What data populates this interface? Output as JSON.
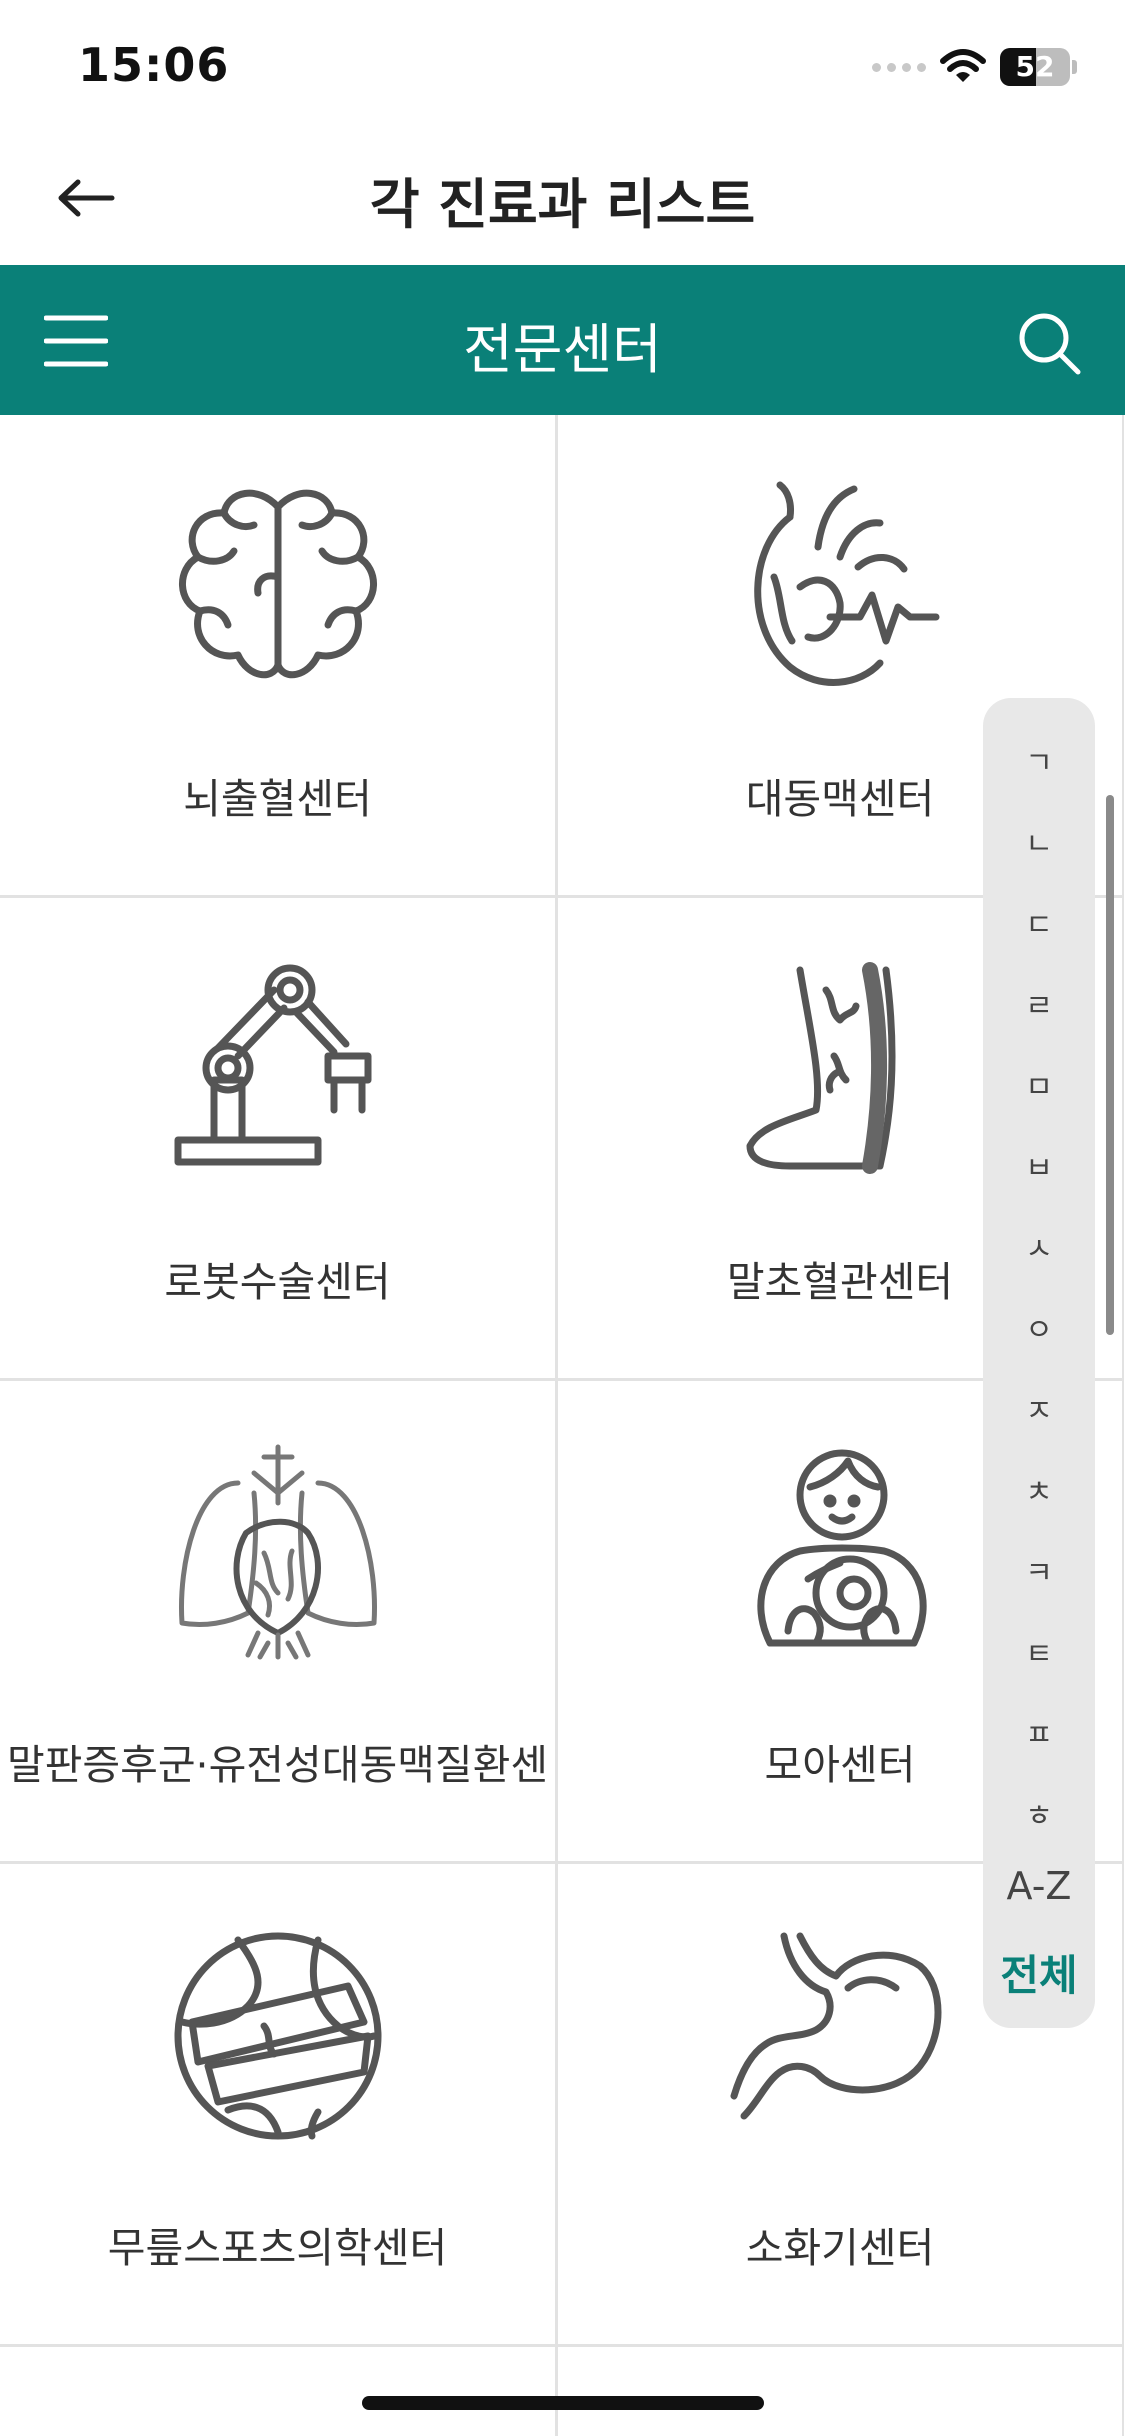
{
  "status_bar": {
    "time": "15:06",
    "battery": "52"
  },
  "nav": {
    "title": "각 진료과 리스트",
    "back_icon": "arrow-left-icon"
  },
  "header": {
    "title": "전문센터",
    "menu_icon": "hamburger-menu-icon",
    "search_icon": "search-icon",
    "color": "#0a8078"
  },
  "centers": [
    {
      "label": "뇌출혈센터",
      "icon": "brain-icon"
    },
    {
      "label": "대동맥센터",
      "icon": "heart-aorta-icon"
    },
    {
      "label": "로봇수술센터",
      "icon": "robot-arm-icon"
    },
    {
      "label": "말초혈관센터",
      "icon": "leg-vessel-icon"
    },
    {
      "label": "말판증후군·유전성대동맥질환센",
      "icon": "lungs-heart-icon"
    },
    {
      "label": "모아센터",
      "icon": "mother-baby-icon"
    },
    {
      "label": "무릎스포츠의학센터",
      "icon": "knee-bandage-icon"
    },
    {
      "label": "소화기센터",
      "icon": "stomach-icon"
    }
  ],
  "index_bar": {
    "consonants": [
      "ㄱ",
      "ㄴ",
      "ㄷ",
      "ㄹ",
      "ㅁ",
      "ㅂ",
      "ㅅ",
      "ㅇ",
      "ㅈ",
      "ㅊ",
      "ㅋ",
      "ㅌ",
      "ㅍ",
      "ㅎ"
    ],
    "az": "A-Z",
    "all": "전체"
  }
}
